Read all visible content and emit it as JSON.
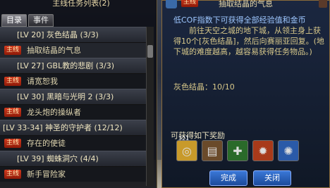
{
  "left_panel": {
    "title": "主线任务列表(2)",
    "tabs": [
      {
        "label": "目录"
      },
      {
        "label": "事件"
      }
    ],
    "quests": [
      {
        "title": "[LV 20] 灰色结晶 (3/3)",
        "badge": "主线",
        "sub": "抽取结晶的气息"
      },
      {
        "title": "[LV 27] GBL教的悲剧 (3/3)",
        "badge": "主线",
        "sub": "请宽恕我"
      },
      {
        "title": "[LV 30] 黑暗与光明 2 (3/3)",
        "badge": "主线",
        "sub": "龙头炮的操纵者"
      },
      {
        "title": "[LV 33-34] 神圣的守护者 (12/12)",
        "badge": "主线",
        "sub": "存在的使徒"
      },
      {
        "title": "[LV 39] 蜘蛛洞穴 (4/4)",
        "badge": "主线",
        "sub": "新手冒险家"
      }
    ]
  },
  "right_panel": {
    "badge": "主线",
    "title": "抽取结晶的气息",
    "line1": "低COF指数下可获得全部经验值和金币",
    "line2": "前往天空之城的地下城，从领主身上获得10个[灰色结晶]，然后向赛丽亚回复。(地下城的难度越高，越容易获得任务物品。)",
    "progress_name": "灰色结晶：",
    "progress_value": "10/10",
    "reward_label": "可获得如下奖励",
    "rewards": [
      {
        "icon": "coin-icon",
        "glyph": "◎",
        "count": "321",
        "color": "#c89a2a"
      },
      {
        "icon": "book-icon",
        "glyph": "▤",
        "count": "",
        "color": "#6a4a2a"
      },
      {
        "icon": "potion-exp-icon",
        "glyph": "✚",
        "count": "",
        "color": "#2a6a2a"
      },
      {
        "icon": "fire-orb-icon",
        "glyph": "✹",
        "count": "",
        "color": "#a83a1a"
      },
      {
        "icon": "blue-orb-icon",
        "glyph": "✺",
        "count": "",
        "color": "#2a5aa8"
      }
    ],
    "complete_button": "完成",
    "close_button": "关闭"
  }
}
